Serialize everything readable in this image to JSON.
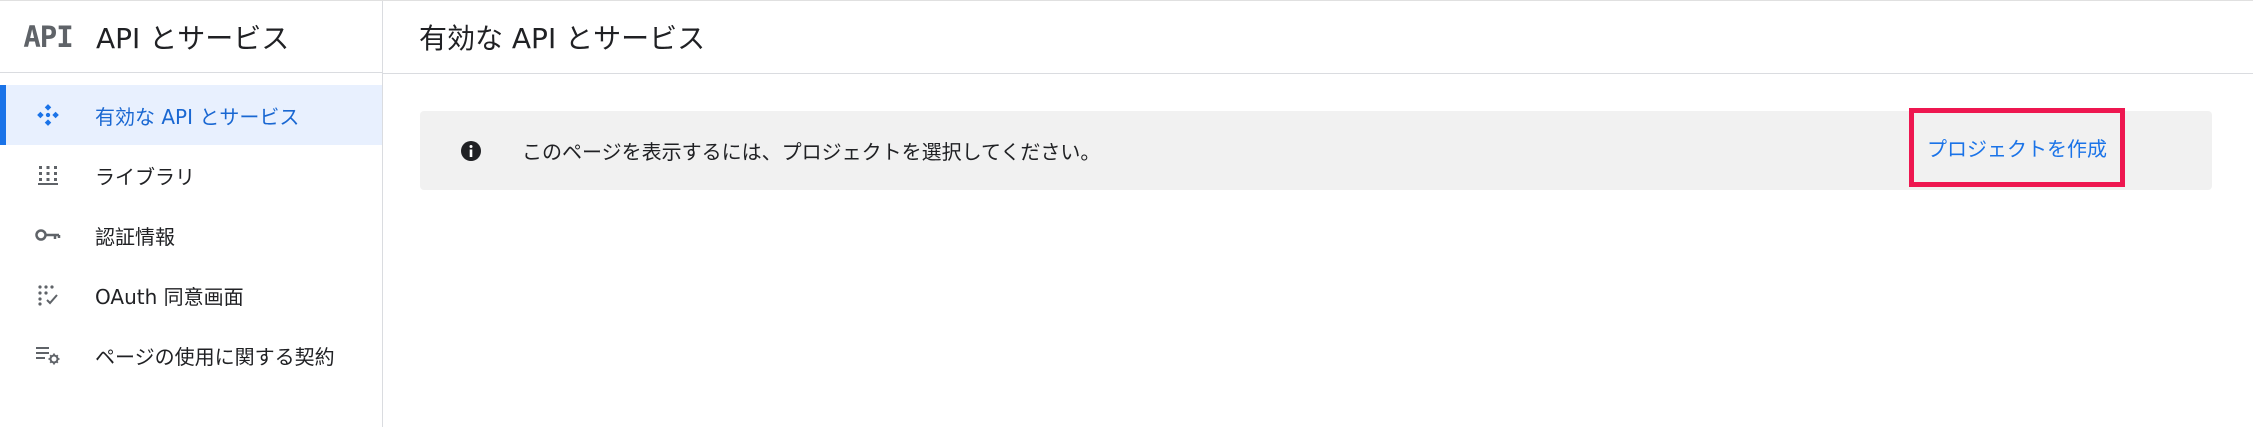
{
  "sidebar": {
    "logo": "API",
    "title": "API とサービス",
    "items": [
      {
        "label": "有効な API とサービス",
        "icon": "enabled-apis-icon",
        "active": true
      },
      {
        "label": "ライブラリ",
        "icon": "library-icon",
        "active": false
      },
      {
        "label": "認証情報",
        "icon": "key-icon",
        "active": false
      },
      {
        "label": "OAuth 同意画面",
        "icon": "oauth-consent-icon",
        "active": false
      },
      {
        "label": "ページの使用に関する契約",
        "icon": "page-usage-agreements-icon",
        "active": false
      }
    ]
  },
  "main": {
    "title": "有効な API とサービス",
    "banner": {
      "icon": "info-icon",
      "message": "このページを表示するには、プロジェクトを選択してください。",
      "action_label": "プロジェクトを作成"
    }
  },
  "colors": {
    "accent": "#1a73e8",
    "active_bg": "#e8f0fe",
    "banner_bg": "#f1f1f1",
    "highlight_border": "#ee1750",
    "icon_gray": "#5f6368"
  }
}
